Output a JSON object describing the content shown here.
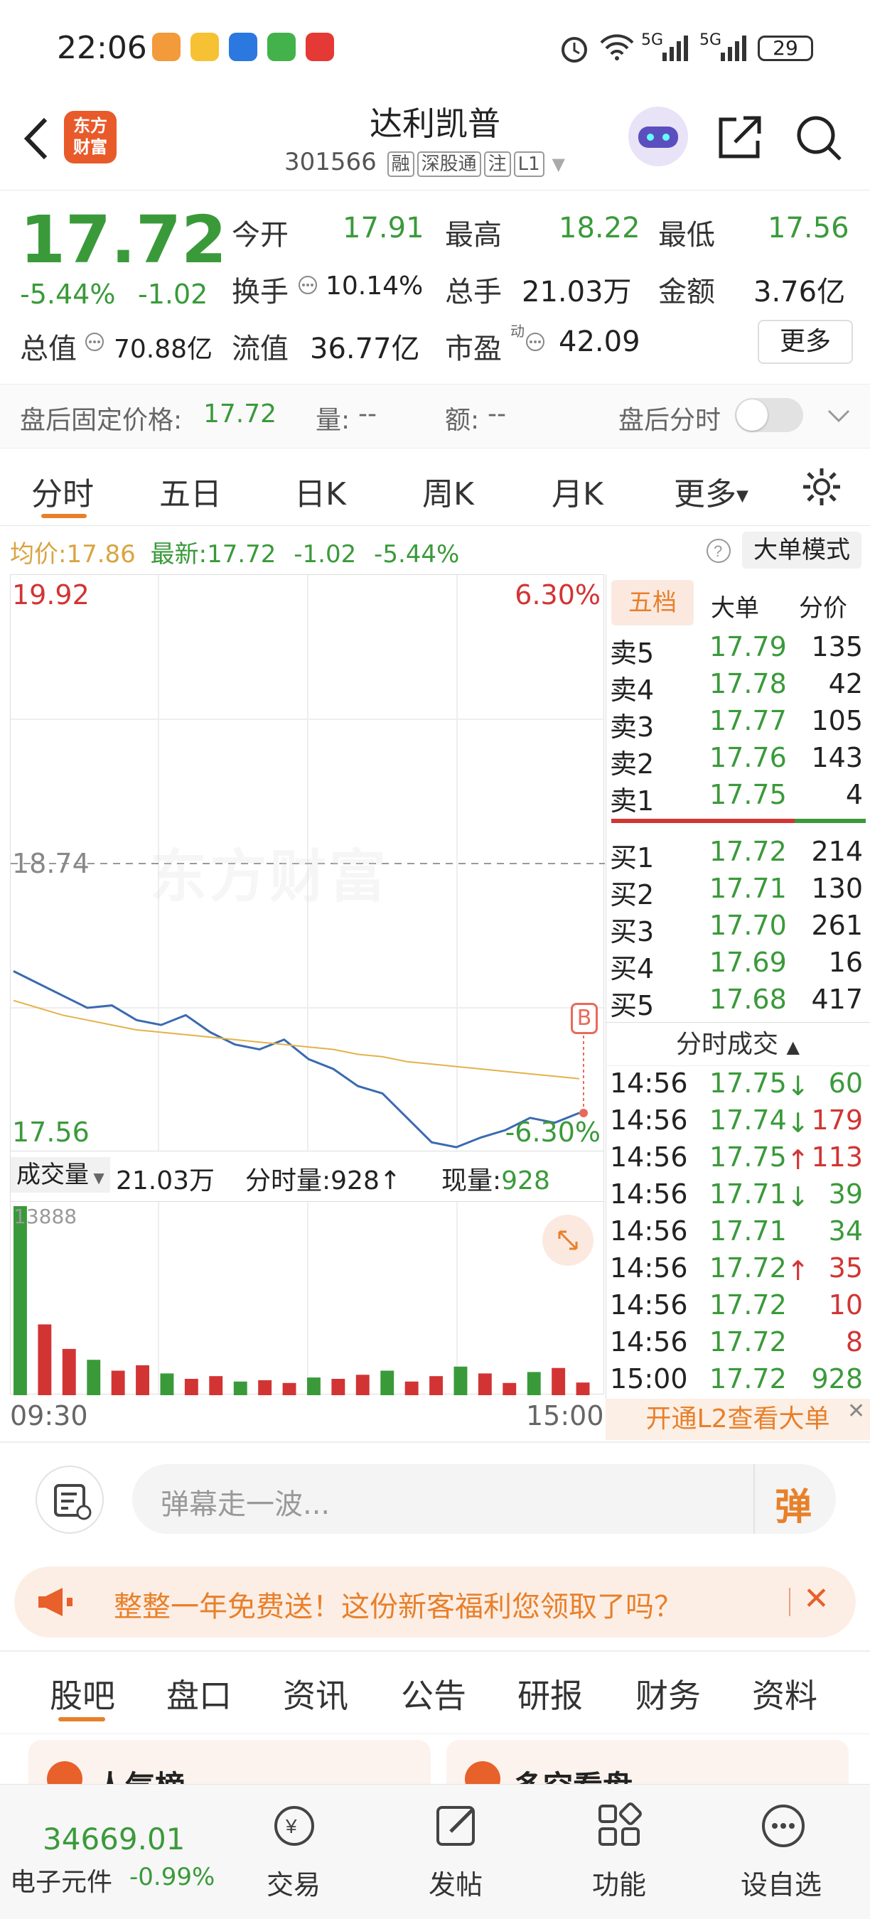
{
  "status_bar": {
    "time": "22:06",
    "battery": "29",
    "network1": "5G",
    "network2": "5G"
  },
  "header": {
    "app_logo_line1": "东方",
    "app_logo_line2": "财富",
    "stock_name": "达利凯普",
    "stock_code": "301566",
    "tags": [
      "融",
      "深股通",
      "注",
      "L1"
    ]
  },
  "quote": {
    "price": "17.72",
    "change_pct": "-5.44%",
    "change": "-1.02",
    "open_label": "今开",
    "open": "17.91",
    "high_label": "最高",
    "high": "18.22",
    "low_label": "最低",
    "low": "17.56",
    "turnover_label": "换手",
    "turnover": "10.14%",
    "volume_label": "总手",
    "volume": "21.03万",
    "amount_label": "金额",
    "amount": "3.76亿",
    "mktcap_label": "总值",
    "mktcap": "70.88亿",
    "float_label": "流值",
    "float_cap": "36.77亿",
    "pe_label": "市盈",
    "pe_sup": "动",
    "pe": "42.09",
    "more_button": "更多"
  },
  "after_hours": {
    "price_label": "盘后固定价格:",
    "price": "17.72",
    "vol_label": "量:",
    "vol": "--",
    "amt_label": "额:",
    "amt": "--",
    "toggle_label": "盘后分时"
  },
  "chart_tabs": [
    "分时",
    "五日",
    "日K",
    "周K",
    "月K",
    "更多"
  ],
  "chart_info": {
    "avg_label": "均价:",
    "avg": "17.86",
    "latest_label": "最新:",
    "latest": "17.72",
    "change": "-1.02",
    "change_pct": "-5.44%",
    "mode_button": "大单模式"
  },
  "chart_axis": {
    "top_price": "19.92",
    "top_pct": "6.30%",
    "mid_price": "18.74",
    "bottom_price": "17.56",
    "bottom_pct": "-6.30%",
    "watermark": "东方财富",
    "time_start": "09:30",
    "time_end": "15:00",
    "b_marker": "B"
  },
  "volume_info": {
    "label": "成交量",
    "total": "21.03万",
    "min_label": "分时量:",
    "min_val": "928↑",
    "now_label": "现量:",
    "now_val": "928",
    "max": "13888"
  },
  "chart_data": {
    "type": "line",
    "title": "",
    "x": [
      "09:30",
      "15:00"
    ],
    "ylim": [
      17.56,
      19.92
    ],
    "series": [
      {
        "values": [
          18.3,
          18.25,
          18.2,
          18.15,
          18.16,
          18.1,
          18.08,
          18.12,
          18.05,
          18.0,
          17.98,
          18.02,
          17.94,
          17.9,
          17.83,
          17.8,
          17.7,
          17.6,
          17.58,
          17.62,
          17.65,
          17.7,
          17.68,
          17.72
        ]
      },
      {
        "values": [
          18.18,
          18.15,
          18.12,
          18.1,
          18.08,
          18.06,
          18.05,
          18.04,
          18.03,
          18.02,
          18.01,
          18.0,
          17.99,
          17.98,
          17.96,
          17.95,
          17.93,
          17.92,
          17.91,
          17.9,
          17.89,
          17.88,
          17.87,
          17.86
        ]
      }
    ],
    "volume": {
      "ylim": [
        0,
        13888
      ],
      "values": [
        13888,
        5200,
        3400,
        2600,
        1800,
        2200,
        1600,
        1200,
        1400,
        1000,
        1100,
        900,
        1300,
        1200,
        1500,
        1800,
        1000,
        1400,
        2100,
        1600,
        900,
        1700,
        2000,
        928
      ]
    }
  },
  "order_book": {
    "tabs": [
      "五档",
      "大单",
      "分价"
    ],
    "sells": [
      {
        "label": "卖5",
        "price": "17.79",
        "qty": "135"
      },
      {
        "label": "卖4",
        "price": "17.78",
        "qty": "42"
      },
      {
        "label": "卖3",
        "price": "17.77",
        "qty": "105"
      },
      {
        "label": "卖2",
        "price": "17.76",
        "qty": "143"
      },
      {
        "label": "卖1",
        "price": "17.75",
        "qty": "4"
      }
    ],
    "buys": [
      {
        "label": "买1",
        "price": "17.72",
        "qty": "214"
      },
      {
        "label": "买2",
        "price": "17.71",
        "qty": "130"
      },
      {
        "label": "买3",
        "price": "17.70",
        "qty": "261"
      },
      {
        "label": "买4",
        "price": "17.69",
        "qty": "16"
      },
      {
        "label": "买5",
        "price": "17.68",
        "qty": "417"
      }
    ],
    "trades_title": "分时成交",
    "trades": [
      {
        "time": "14:56",
        "price": "17.75↓",
        "qty": "60",
        "qcolor": "#3a9a3a"
      },
      {
        "time": "14:56",
        "price": "17.74↓",
        "qty": "179",
        "qcolor": "#d23434"
      },
      {
        "time": "14:56",
        "price": "17.75↑",
        "qty": "113",
        "qcolor": "#d23434"
      },
      {
        "time": "14:56",
        "price": "17.71↓",
        "qty": "39",
        "qcolor": "#3a9a3a"
      },
      {
        "time": "14:56",
        "price": "17.71",
        "qty": "34",
        "qcolor": "#3a9a3a"
      },
      {
        "time": "14:56",
        "price": "17.72↑",
        "qty": "35",
        "qcolor": "#d23434"
      },
      {
        "time": "14:56",
        "price": "17.72",
        "qty": "10",
        "qcolor": "#d23434"
      },
      {
        "time": "14:56",
        "price": "17.72",
        "qty": "8",
        "qcolor": "#d23434"
      },
      {
        "time": "15:00",
        "price": "17.72",
        "qty": "928",
        "qcolor": "#3a9a3a"
      }
    ],
    "l2_banner": "开通L2查看大单"
  },
  "comment": {
    "placeholder": "弹幕走一波...",
    "danmu_button": "弹"
  },
  "promo": {
    "text": "整整一年免费送！这份新客福利您领取了吗？"
  },
  "section_tabs": [
    "股吧",
    "盘口",
    "资讯",
    "公告",
    "研报",
    "财务",
    "资料"
  ],
  "peek": {
    "left": "人气榜",
    "right": "多空看盘"
  },
  "bottom_nav": {
    "index_value": "34669.01",
    "index_name": "电子元件",
    "index_change": "-0.99%",
    "items": [
      "交易",
      "发帖",
      "功能",
      "设自选"
    ]
  },
  "colors": {
    "up": "#d23434",
    "down": "#3a9a3a",
    "accent": "#e8802a",
    "avg_line": "#e3b24a",
    "price_line": "#3a6ab0"
  }
}
